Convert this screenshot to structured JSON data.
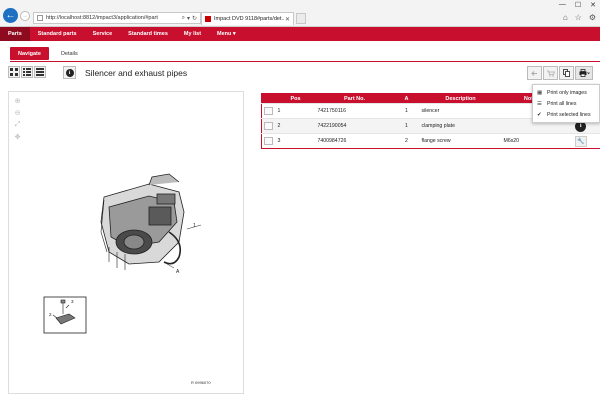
{
  "browser": {
    "url": "http://localhost:8812/impact3/application/#part",
    "tab_title": "Impact DVD 9118#parts/det...",
    "back_label": "←",
    "fwd_label": "→",
    "search_label": "⌕",
    "lock_label": "▾",
    "refresh_label": "↻",
    "tab_close": "✕",
    "win_min": "—",
    "win_max": "☐",
    "win_close": "✕",
    "home_icon": "⌂",
    "star_icon": "☆",
    "gear_icon": "⚙"
  },
  "appnav": {
    "items": [
      "Parts",
      "Standard parts",
      "Service",
      "Standard times",
      "My list",
      "Menu ▾"
    ]
  },
  "subtabs": {
    "navigate": "Navigate",
    "details": "Details"
  },
  "page": {
    "title": "Silencer and exhaust pipes",
    "info_label": "i",
    "figure_no": "R 0996070"
  },
  "table": {
    "headers": [
      "",
      "Pos",
      "Part No.",
      "A",
      "Description",
      "Notes",
      ""
    ],
    "rows": [
      {
        "pos": "1",
        "part_no": "7421750116",
        "a": "1",
        "description": "silencer",
        "notes": "",
        "action": "info"
      },
      {
        "pos": "2",
        "part_no": "7422190054",
        "a": "1",
        "description": "clamping plate",
        "notes": "",
        "action": "info"
      },
      {
        "pos": "3",
        "part_no": "7400984726",
        "a": "2",
        "description": "flange screw",
        "notes": "M6x20",
        "action": "tool"
      }
    ]
  },
  "print_menu": {
    "items": [
      {
        "label": "Print only images",
        "icon": "grid-icon"
      },
      {
        "label": "Print all lines",
        "icon": "list-icon"
      },
      {
        "label": "Print selected lines",
        "icon": "check-icon"
      }
    ]
  },
  "diagram_labels": {
    "callout1": "1",
    "calloutA": "A",
    "detail2": "2",
    "detail3": "3"
  },
  "colors": {
    "brand_red": "#c8102e",
    "dark_red": "#8d0a1f",
    "browser_blue": "#1f6fc2"
  }
}
